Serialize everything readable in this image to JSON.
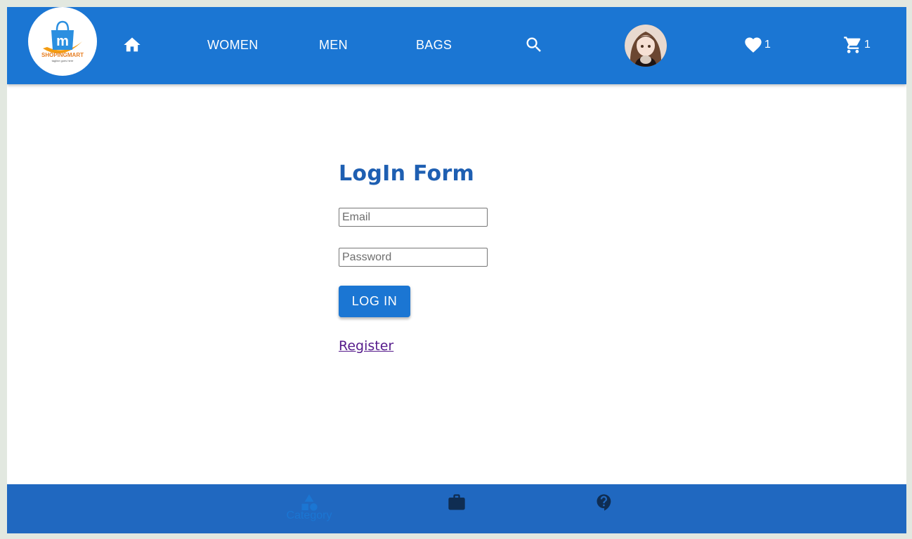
{
  "header": {
    "logo": {
      "brand": "SHOPINGMART",
      "tagline": "tagline goes here",
      "icon": "shopping-bag-logo"
    },
    "home_icon": "home-icon",
    "nav_links": [
      {
        "label": "WOMEN"
      },
      {
        "label": "MEN"
      },
      {
        "label": "BAGS"
      }
    ],
    "search_icon": "search-icon",
    "avatar_icon": "user-avatar",
    "wishlist": {
      "icon": "heart-icon",
      "count": "1"
    },
    "cart": {
      "icon": "cart-icon",
      "count": "1"
    }
  },
  "login_form": {
    "title": "LogIn Form",
    "email_placeholder": "Email",
    "password_placeholder": "Password",
    "submit_label": "LOG IN",
    "register_link": "Register"
  },
  "bottom_nav": {
    "items": [
      {
        "label": "Category",
        "icon": "category-icon",
        "active": true
      },
      {
        "label": "",
        "icon": "briefcase-icon",
        "active": false
      },
      {
        "label": "",
        "icon": "help-icon",
        "active": false
      }
    ]
  },
  "colors": {
    "primary": "#1b76d3",
    "title": "#1e5fb2",
    "bottom_nav": "#2068c0",
    "link_visited": "#551a8b",
    "page_border": "#e2e8e0"
  }
}
